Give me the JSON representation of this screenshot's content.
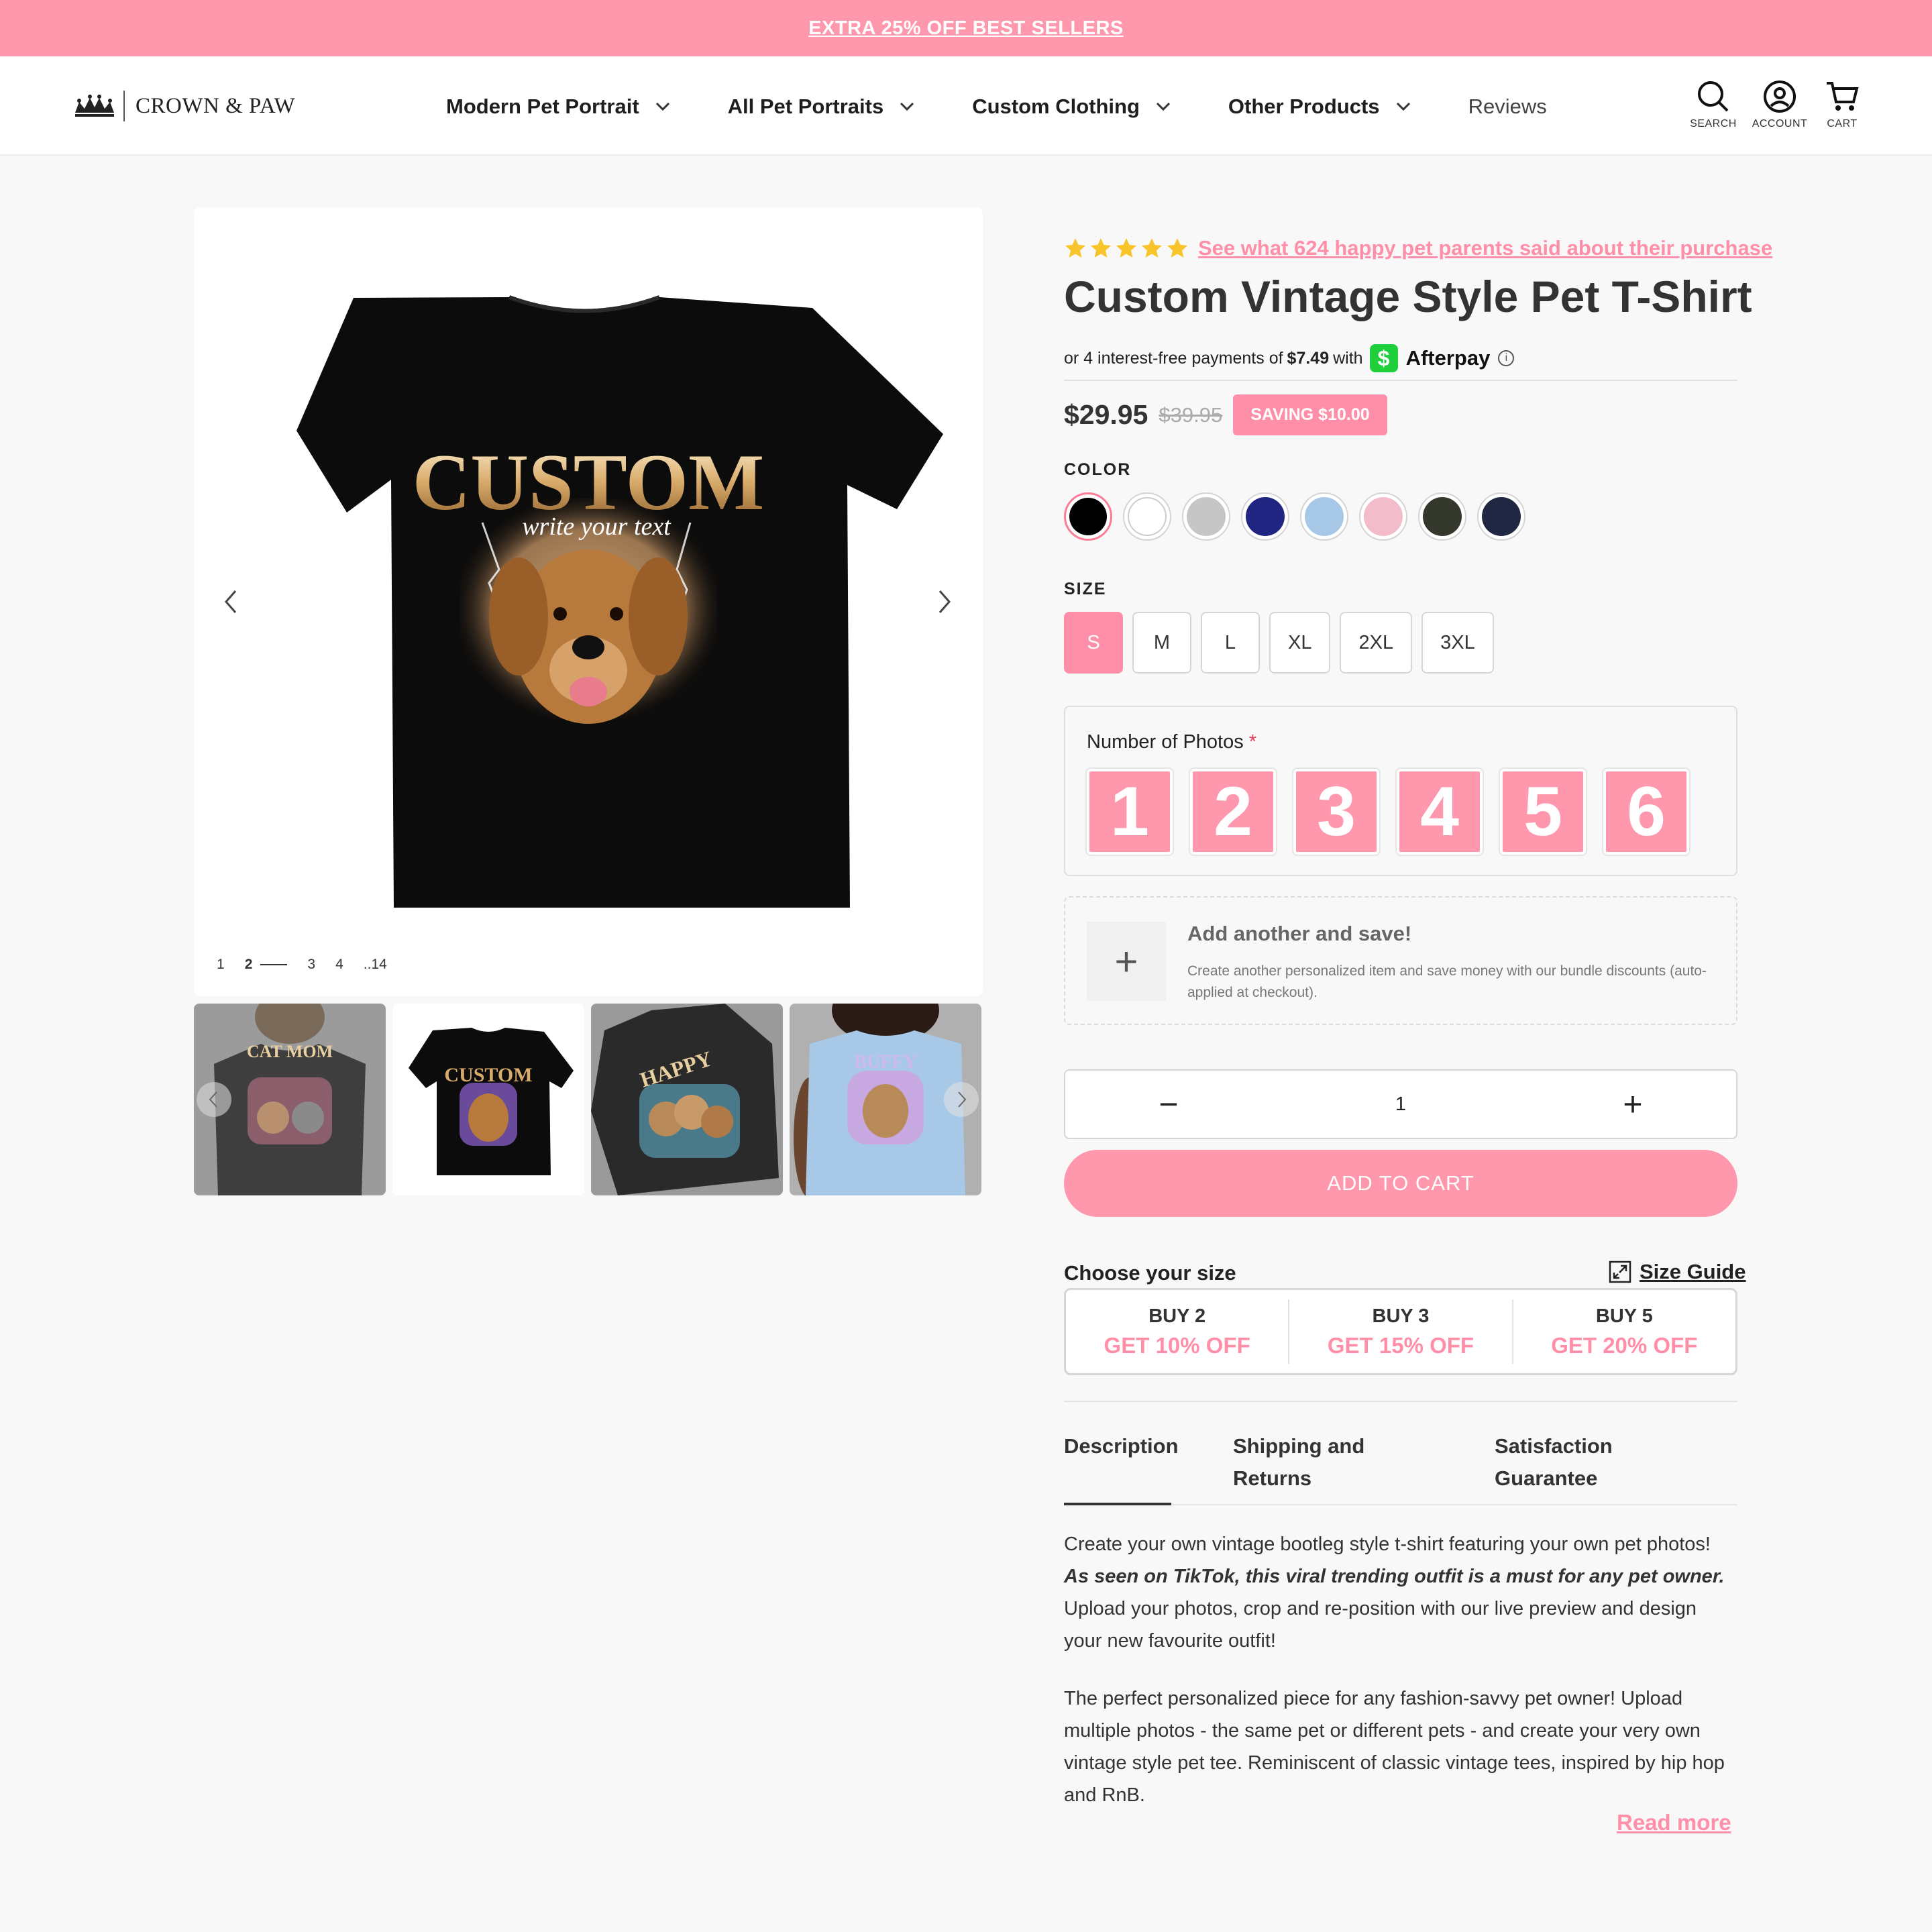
{
  "announcement": {
    "text": "EXTRA 25% OFF BEST SELLERS"
  },
  "header": {
    "brand": "CROWN & PAW",
    "nav": [
      {
        "label": "Modern Pet Portrait"
      },
      {
        "label": "All Pet Portraits"
      },
      {
        "label": "Custom Clothing"
      },
      {
        "label": "Other Products"
      },
      {
        "label": "Reviews"
      }
    ],
    "icons": {
      "search": "SEARCH",
      "account": "ACCOUNT",
      "cart": "CART"
    }
  },
  "gallery": {
    "main_print": {
      "headline": "CUSTOM",
      "script": "write your text"
    },
    "pager": [
      "1",
      "2",
      "3",
      "4",
      "..14"
    ],
    "thumbs": [
      {
        "headline": "CAT MOM",
        "icon": "woman-wearing-black-tee"
      },
      {
        "headline": "CUSTOM",
        "icon": "black-tee-dog-print"
      },
      {
        "headline": "HAPPY",
        "icon": "black-tee-two-dogs"
      },
      {
        "headline": "BUFFY",
        "icon": "woman-wearing-light-blue-tee"
      }
    ]
  },
  "product": {
    "rating": 5,
    "reviews_link": "See what 624 happy pet parents said about their purchase",
    "title": "Custom Vintage Style Pet T-Shirt",
    "afterpay": {
      "prefix": "or 4 interest-free payments of",
      "amount": "$7.49",
      "with": "with",
      "badge": "$",
      "name": "Afterpay",
      "info": "i"
    },
    "price": "$29.95",
    "compare_price": "$39.95",
    "saving": "SAVING $10.00",
    "color_label": "COLOR",
    "colors": [
      "#000000",
      "#ffffff",
      "#c6c6c6",
      "#1f2580",
      "#a6c8e6",
      "#f3bccb",
      "#34382c",
      "#1f2742"
    ],
    "selected_color_index": 0,
    "size_label": "SIZE",
    "sizes": [
      "S",
      "M",
      "L",
      "XL",
      "2XL",
      "3XL"
    ],
    "selected_size": "S",
    "photos_label": "Number of Photos",
    "required_mark": "*",
    "photo_options": [
      "1",
      "2",
      "3",
      "4",
      "5",
      "6"
    ],
    "add_another": {
      "plus": "+",
      "title": "Add another and save!",
      "desc": "Create another personalized item and save money with our bundle discounts (auto-applied at checkout)."
    },
    "quantity": {
      "minus": "−",
      "value": "1",
      "plus": "+"
    },
    "add_to_cart": "ADD TO CART",
    "choose_size": "Choose your size",
    "size_guide": "Size Guide",
    "bundles": [
      {
        "buy": "BUY 2",
        "off": "GET 10% OFF"
      },
      {
        "buy": "BUY 3",
        "off": "GET 15% OFF"
      },
      {
        "buy": "BUY 5",
        "off": "GET 20% OFF"
      }
    ],
    "tabs": [
      {
        "label": "Description"
      },
      {
        "label": "Shipping and Returns"
      },
      {
        "label": "Satisfaction Guarantee"
      }
    ],
    "description": {
      "p1_a": "Create your own vintage bootleg style t-shirt featuring your own pet photos!",
      "p1_b": "As seen on TikTok, this viral trending outfit is a must for any pet owner.",
      "p1_c": "Upload your photos, crop and re-position with our live preview and design your new favourite outfit!",
      "p2": "The perfect personalized piece for any fashion-savvy pet owner! Upload multiple photos - the same pet or different pets - and create your very own vintage style pet tee. Reminiscent of classic vintage tees, inspired by hip hop and RnB."
    },
    "read_more": "Read more"
  },
  "colors": {
    "accent": "#ff97ad",
    "accent_text": "#ff8fa8",
    "afterpay_green": "#1fcf3c"
  }
}
